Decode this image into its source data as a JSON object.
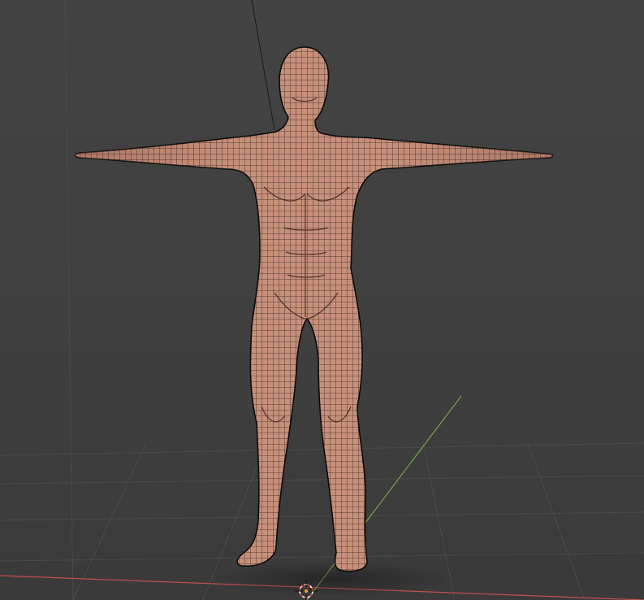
{
  "app": "3d-viewport",
  "scene": {
    "object": "human-base-mesh",
    "pose": "t-pose",
    "display_mode": "solid-with-wireframe-overlay"
  },
  "colors": {
    "background": "#3f3f3f",
    "grid_line": "#4a4a4a",
    "x_axis": "#c0504d",
    "y_axis": "#7aa34a",
    "skin": "#c7907a",
    "skin_shade": "#9a6655",
    "wire": "#1c1410",
    "outline": "#0a0a0a"
  },
  "icons": {
    "cursor": "3d-cursor-icon"
  }
}
